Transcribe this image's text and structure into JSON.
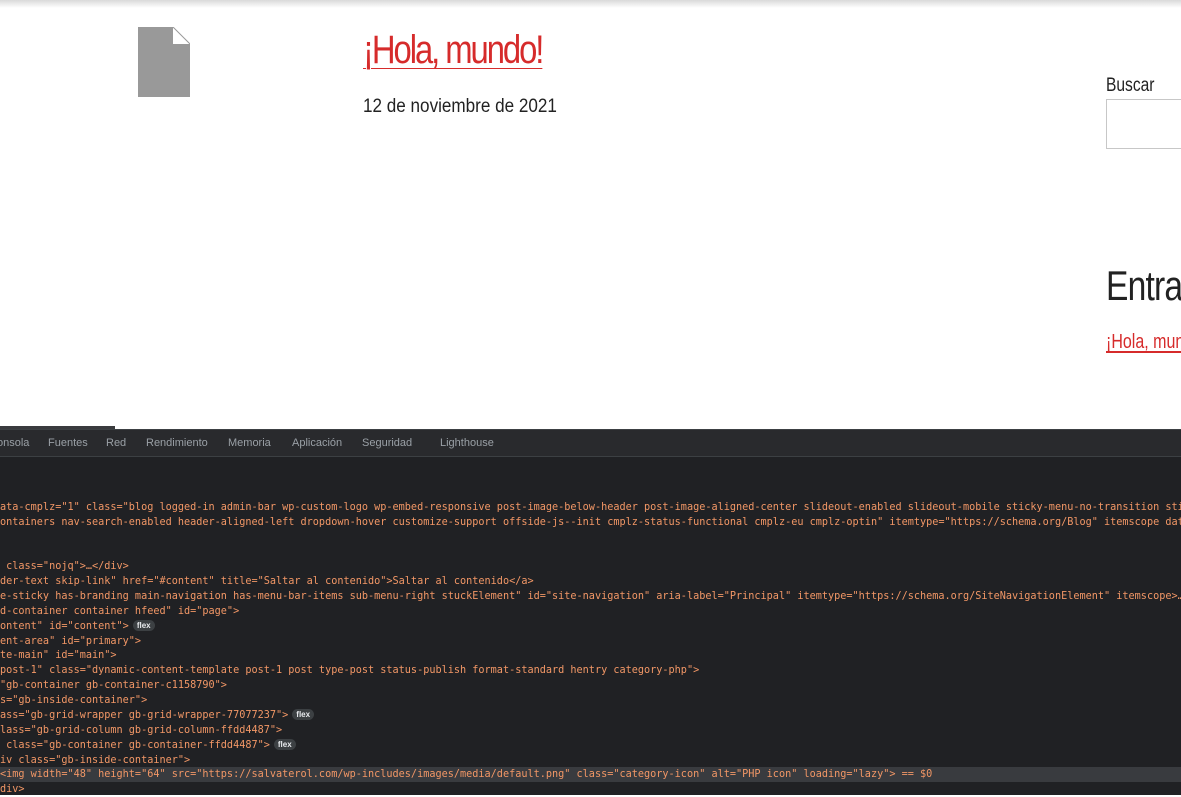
{
  "page": {
    "post_title": "¡Hola, mundo!",
    "post_date": "12 de noviembre de 2021",
    "search_label": "Buscar",
    "recent_heading": "Entrad",
    "recent_link": "¡Hola, mundo"
  },
  "devtools": {
    "tabs": [
      "onsola",
      "Fuentes",
      "Red",
      "Rendimiento",
      "Memoria",
      "Aplicación",
      "Seguridad",
      "Lighthouse"
    ],
    "badge_label": "flex",
    "lines": [
      "ata-cmplz=\"1\" class=\"blog logged-in admin-bar wp-custom-logo wp-embed-responsive post-image-below-header post-image-aligned-center slideout-enabled slideout-mobile sticky-menu-no-transition sticky-en",
      "ontainers nav-search-enabled header-aligned-left dropdown-hover customize-support offside-js--init cmplz-status-functional cmplz-eu cmplz-optin\" itemtype=\"https://schema.org/Blog\" itemscope data-new-g",
      " class=\"nojq\">…</div>",
      "der-text skip-link\" href=\"#content\" title=\"Saltar al contenido\">Saltar al contenido</a>",
      "e-sticky has-branding main-navigation has-menu-bar-items sub-menu-right stuckElement\" id=\"site-navigation\" aria-label=\"Principal\" itemtype=\"https://schema.org/SiteNavigationElement\" itemscope>…</nav>",
      "d-container container hfeed\" id=\"page\">",
      "ontent\" id=\"content\">",
      "ent-area\" id=\"primary\">",
      "te-main\" id=\"main\">",
      "post-1\" class=\"dynamic-content-template post-1 post type-post status-publish format-standard hentry category-php\">",
      "\"gb-container gb-container-c1158790\">",
      "s=\"gb-inside-container\">",
      "ass=\"gb-grid-wrapper gb-grid-wrapper-77077237\">",
      "lass=\"gb-grid-column gb-grid-column-ffdd4487\">",
      " class=\"gb-container gb-container-ffdd4487\">",
      "iv class=\"gb-inside-container\">",
      "<img width=\"48\" height=\"64\" src=\"https://salvaterol.com/wp-includes/images/media/default.png\" class=\"category-icon\" alt=\"PHP icon\" loading=\"lazy\"> == $0",
      "div>"
    ]
  }
}
